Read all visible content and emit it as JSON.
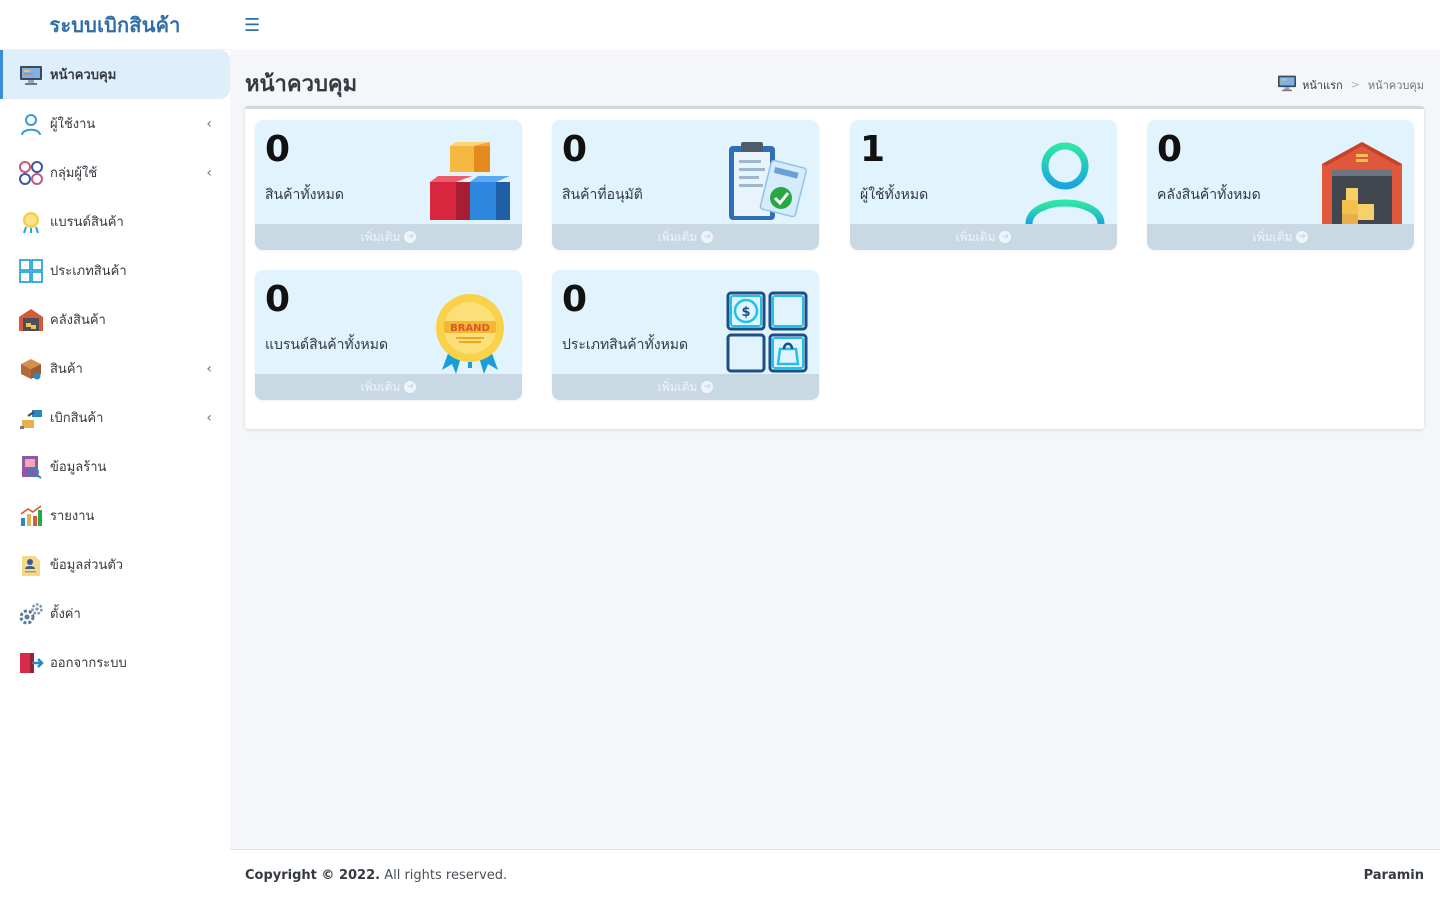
{
  "app": {
    "title": "ระบบเบิกสินค้า"
  },
  "header": {
    "menu_toggle_icon": "hamburger-icon"
  },
  "sidebar": {
    "items": [
      {
        "label": "หน้าควบคุม",
        "icon": "monitor-icon",
        "active": true,
        "has_submenu": false
      },
      {
        "label": "ผู้ใช้งาน",
        "icon": "user-icon",
        "active": false,
        "has_submenu": true
      },
      {
        "label": "กลุ่มผู้ใช้",
        "icon": "group-icon",
        "active": false,
        "has_submenu": true
      },
      {
        "label": "แบรนด์สินค้า",
        "icon": "brand-badge-icon",
        "active": false,
        "has_submenu": false
      },
      {
        "label": "ประเภทสินค้า",
        "icon": "category-grid-icon",
        "active": false,
        "has_submenu": false
      },
      {
        "label": "คลังสินค้า",
        "icon": "warehouse-icon",
        "active": false,
        "has_submenu": false
      },
      {
        "label": "สินค้า",
        "icon": "box-icon",
        "active": false,
        "has_submenu": true
      },
      {
        "label": "เบิกสินค้า",
        "icon": "withdraw-icon",
        "active": false,
        "has_submenu": true
      },
      {
        "label": "ข้อมูลร้าน",
        "icon": "store-info-icon",
        "active": false,
        "has_submenu": false
      },
      {
        "label": "รายงาน",
        "icon": "report-chart-icon",
        "active": false,
        "has_submenu": false
      },
      {
        "label": "ข้อมูลส่วนตัว",
        "icon": "profile-icon",
        "active": false,
        "has_submenu": false
      },
      {
        "label": "ตั้งค่า",
        "icon": "gear-icon",
        "active": false,
        "has_submenu": false
      },
      {
        "label": "ออกจากระบบ",
        "icon": "logout-icon",
        "active": false,
        "has_submenu": false
      }
    ],
    "submenu_chevron": "‹"
  },
  "page": {
    "title": "หน้าควบคุม",
    "breadcrumb": {
      "home": "หน้าแรก",
      "separator": ">",
      "current": "หน้าควบคุม"
    }
  },
  "cards": [
    {
      "count": "0",
      "label": "สินค้าทั้งหมด",
      "more": "เพิ่มเติม",
      "icon": "cubes-icon"
    },
    {
      "count": "0",
      "label": "สินค้าที่อนุมัติ",
      "more": "เพิ่มเติม",
      "icon": "clipboard-check-icon"
    },
    {
      "count": "1",
      "label": "ผู้ใช้ทั้งหมด",
      "more": "เพิ่มเติม",
      "icon": "user-outline-icon"
    },
    {
      "count": "0",
      "label": "คลังสินค้าทั้งหมด",
      "more": "เพิ่มเติม",
      "icon": "warehouse-icon"
    },
    {
      "count": "0",
      "label": "แบรนด์สินค้าทั้งหมด",
      "more": "เพิ่มเติม",
      "icon": "brand-badge-icon"
    },
    {
      "count": "0",
      "label": "ประเภทสินค้าทั้งหมด",
      "more": "เพิ่มเติม",
      "icon": "category-grid-icon"
    }
  ],
  "footer": {
    "copyright": "Copyright © 2022.",
    "rights": " All rights reserved.",
    "author": "Paramin"
  },
  "colors": {
    "brand": "#2f6fa8",
    "active_bg": "#dfeefb",
    "card_bg": "#e1f3fc",
    "card_footer": "#c9d9e4"
  }
}
